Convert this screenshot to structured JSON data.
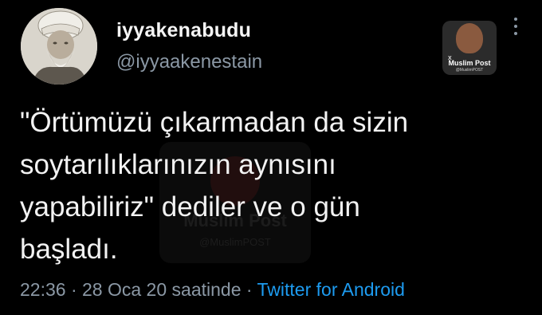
{
  "user": {
    "display_name": "iyyakenabudu",
    "handle": "@iyyaakenestain"
  },
  "watermark": {
    "icon": "x-icon",
    "title": "Muslim Post",
    "subtitle": "@MuslimPOST"
  },
  "center_watermark": {
    "title": "Muslim Post",
    "subtitle": "@MuslimPOST"
  },
  "tweet": {
    "lines": [
      "\"Örtümüzü çıkarmadan da sizin",
      "soytarılıklarınızın aynısını",
      "yapabiliriz\" dediler ve o gün",
      "başladı."
    ]
  },
  "meta": {
    "time": "22:36",
    "sep1": " · ",
    "date": "28 Oca 20 saatinde",
    "sep2": " · ",
    "source": "Twitter for Android"
  },
  "colors": {
    "background": "#000000",
    "text": "#e7e9ea",
    "muted": "#8b98a5",
    "link": "#1d9bf0"
  }
}
